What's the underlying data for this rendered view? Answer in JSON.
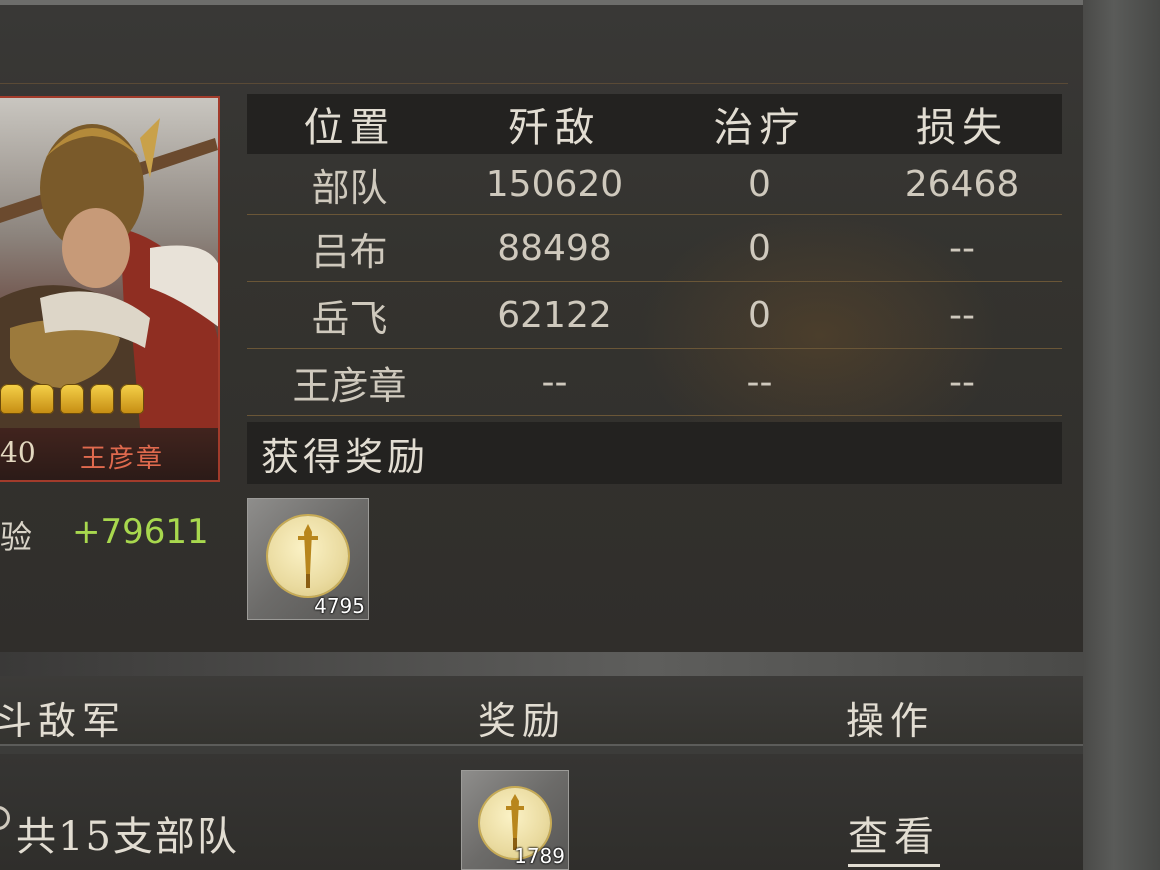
{
  "hero": {
    "level": "40",
    "name": "王彦章",
    "star_count": 5,
    "exp_label": "经验",
    "exp_value": "+79611"
  },
  "stats": {
    "headers": [
      "位置",
      "歼敌",
      "治疗",
      "损失"
    ],
    "rows": [
      [
        "部队",
        "150620",
        "0",
        "26468"
      ],
      [
        "吕布",
        "88498",
        "0",
        "--"
      ],
      [
        "岳飞",
        "62122",
        "0",
        "--"
      ],
      [
        "王彦章",
        "--",
        "--",
        "--"
      ]
    ]
  },
  "reward": {
    "title": "获得奖励",
    "items": [
      {
        "icon": "sword-coin-icon",
        "qty": "4795"
      }
    ]
  },
  "list": {
    "headers": {
      "enemy": "斗敌军",
      "reward": "奖励",
      "action": "操作"
    },
    "rows": [
      {
        "desc": "共15支部队",
        "reward_icon": "sword-coin-icon",
        "reward_qty": "1789",
        "action": "查看"
      }
    ]
  },
  "colors": {
    "accent_gold": "#c7ab55",
    "exp_green": "#a8d84e",
    "portrait_border": "#a23b2b",
    "hero_name": "#e06a4e"
  }
}
